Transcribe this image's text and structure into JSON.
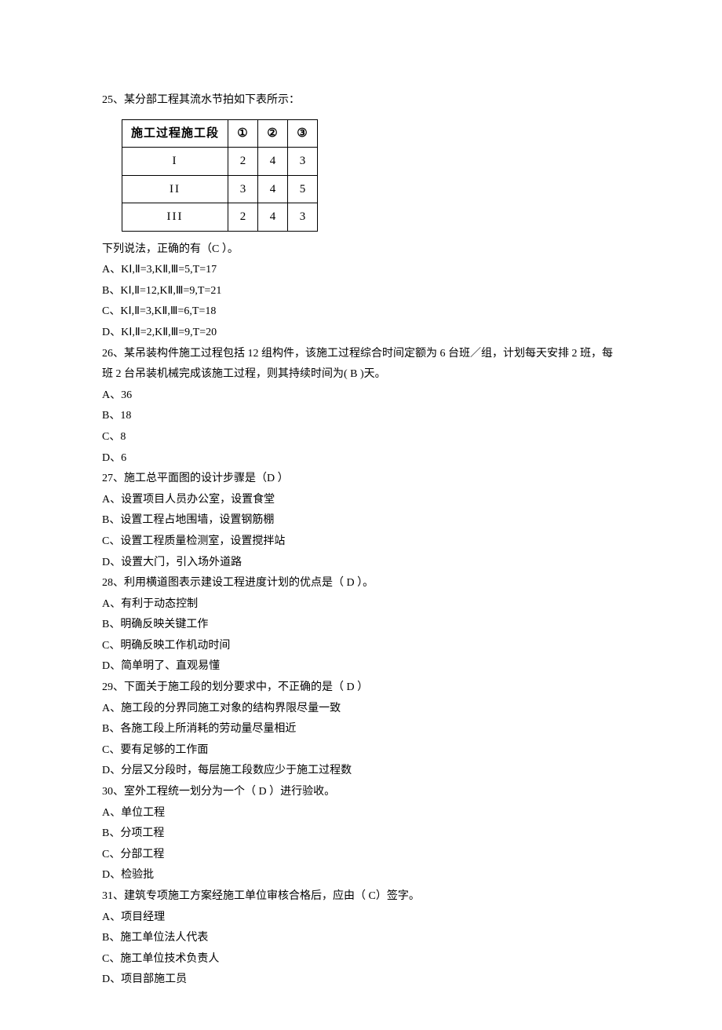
{
  "q25": {
    "stem": "25、某分部工程其流水节拍如下表所示：",
    "table": {
      "header": [
        "施工过程施工段",
        "①",
        "②",
        "③"
      ],
      "rows": [
        [
          "I",
          "2",
          "4",
          "3"
        ],
        [
          "II",
          "3",
          "4",
          "5"
        ],
        [
          "III",
          "2",
          "4",
          "3"
        ]
      ]
    },
    "after": "下列说法，正确的有（C ）。",
    "opts": [
      "A、KⅠ,Ⅱ=3,KⅡ,Ⅲ=5,T=17",
      "B、KⅠ,Ⅱ=12,KⅡ,Ⅲ=9,T=21",
      "C、KⅠ,Ⅱ=3,KⅡ,Ⅲ=6,T=18",
      "D、KⅠ,Ⅱ=2,KⅡ,Ⅲ=9,T=20"
    ]
  },
  "q26": {
    "stem": "26、某吊装构件施工过程包括 12 组构件，该施工过程综合时间定额为 6 台班／组，计划每天安排 2 班，每",
    "stem2": "班 2 台吊装机械完成该施工过程，则其持续时间为(   B  )天。",
    "opts": [
      "A、36",
      "B、18",
      "C、8",
      "D、6"
    ]
  },
  "q27": {
    "stem": "27、施工总平面图的设计步骤是（D  ）",
    "opts": [
      "A、设置项目人员办公室，设置食堂",
      "B、设置工程占地围墙，设置钢筋棚",
      "C、设置工程质量检测室，设置搅拌站",
      "D、设置大门，引入场外道路"
    ]
  },
  "q28": {
    "stem": "28、利用横道图表示建设工程进度计划的优点是（  D   ）。",
    "opts": [
      "A、有利于动态控制",
      "B、明确反映关键工作",
      "C、明确反映工作机动时间",
      "D、简单明了、直观易懂"
    ]
  },
  "q29": {
    "stem": "29、下面关于施工段的划分要求中，不正确的是（   D   ）",
    "opts": [
      "A、施工段的分界同施工对象的结构界限尽量一致",
      "B、各施工段上所消耗的劳动量尽量相近",
      "C、要有足够的工作面",
      "D、分层又分段时，每层施工段数应少于施工过程数"
    ]
  },
  "q30": {
    "stem": "30、室外工程统一划分为一个（   D   ）进行验收。",
    "opts": [
      "A、单位工程",
      "B、分项工程",
      "C、分部工程",
      "D、检验批"
    ]
  },
  "q31": {
    "stem": "31、建筑专项施工方案经施工单位审核合格后，应由（ C）签字。",
    "opts": [
      "A、项目经理",
      "B、施工单位法人代表",
      "C、施工单位技术负责人",
      "D、项目部施工员"
    ]
  }
}
